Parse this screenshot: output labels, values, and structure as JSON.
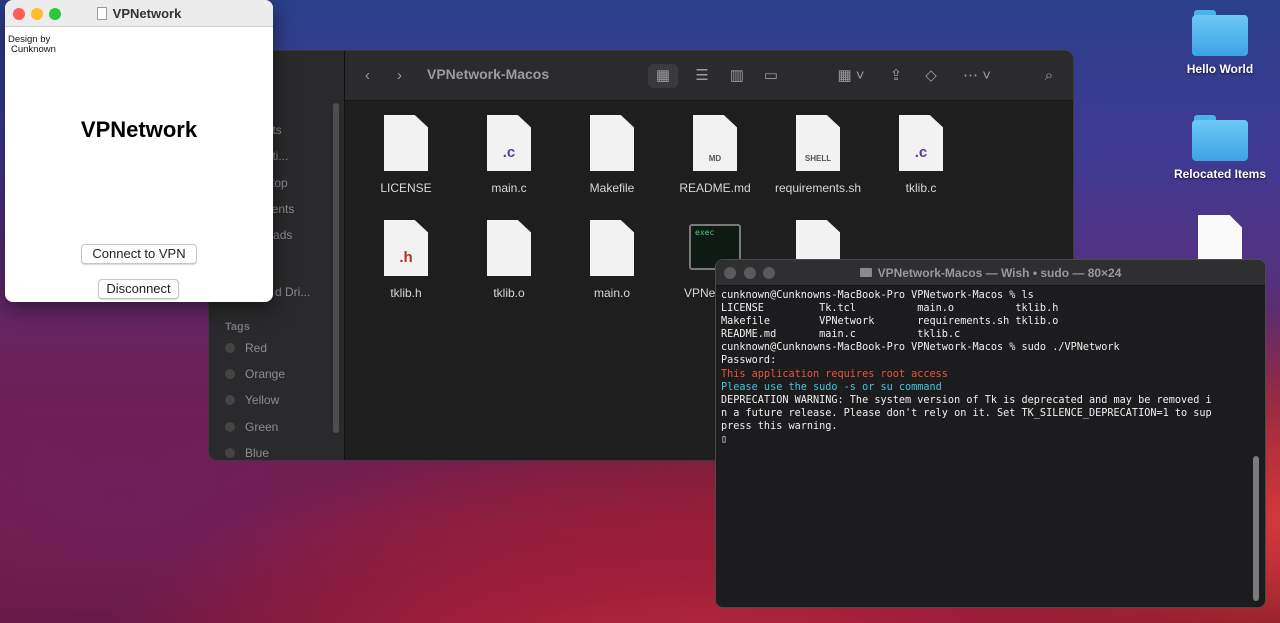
{
  "desktop": {
    "icons": [
      {
        "label": "Hello World",
        "type": "folder"
      },
      {
        "label": "Relocated Items",
        "type": "folder"
      },
      {
        "label": "",
        "type": "document"
      }
    ]
  },
  "vpn_window": {
    "title": "VPNetwork",
    "design_credit_line1": "Design by",
    "design_credit_line2": "Cunknown",
    "heading": "VPNetwork",
    "connect_button": "Connect to VPN",
    "disconnect_button": "Disconnect"
  },
  "finder": {
    "title": "VPNetwork-Macos",
    "sidebar": {
      "items": [
        "ents",
        "icati...",
        "top",
        "uments",
        "nloads",
        "d Dri..."
      ],
      "tags_header": "Tags",
      "tags": [
        "Red",
        "Orange",
        "Yellow",
        "Green",
        "Blue"
      ]
    },
    "files": [
      {
        "name": "LICENSE",
        "badge": ""
      },
      {
        "name": "main.c",
        "badge": ".c"
      },
      {
        "name": "Makefile",
        "badge": ""
      },
      {
        "name": "README.md",
        "badge": "MD"
      },
      {
        "name": "requirements.sh",
        "badge": "SHELL"
      },
      {
        "name": "tklib.c",
        "badge": ".c"
      },
      {
        "name": "tklib.h",
        "badge": ".h"
      },
      {
        "name": "tklib.o",
        "badge": ""
      },
      {
        "name": "main.o",
        "badge": ""
      },
      {
        "name": "VPNe",
        "badge": "exec"
      }
    ]
  },
  "terminal": {
    "title": "VPNetwork-Macos — Wish • sudo — 80×24",
    "lines": [
      {
        "text": "cunknown@Cunknowns-MacBook-Pro VPNetwork-Macos % ls",
        "color": "default"
      },
      {
        "text": "LICENSE         Tk.tcl          main.o          tklib.h",
        "color": "default"
      },
      {
        "text": "Makefile        VPNetwork       requirements.sh tklib.o",
        "color": "default"
      },
      {
        "text": "README.md       main.c          tklib.c",
        "color": "default"
      },
      {
        "text": "cunknown@Cunknowns-MacBook-Pro VPNetwork-Macos % sudo ./VPNetwork",
        "color": "default"
      },
      {
        "text": "Password:",
        "color": "default"
      },
      {
        "text": "This application requires root access",
        "color": "red"
      },
      {
        "text": "Please use the sudo -s or su command",
        "color": "cyan"
      },
      {
        "text": "DEPRECATION WARNING: The system version of Tk is deprecated and may be removed i",
        "color": "default"
      },
      {
        "text": "n a future release. Please don't rely on it. Set TK_SILENCE_DEPRECATION=1 to sup",
        "color": "default"
      },
      {
        "text": "press this warning.",
        "color": "default"
      },
      {
        "text": "▯",
        "color": "default"
      }
    ]
  }
}
